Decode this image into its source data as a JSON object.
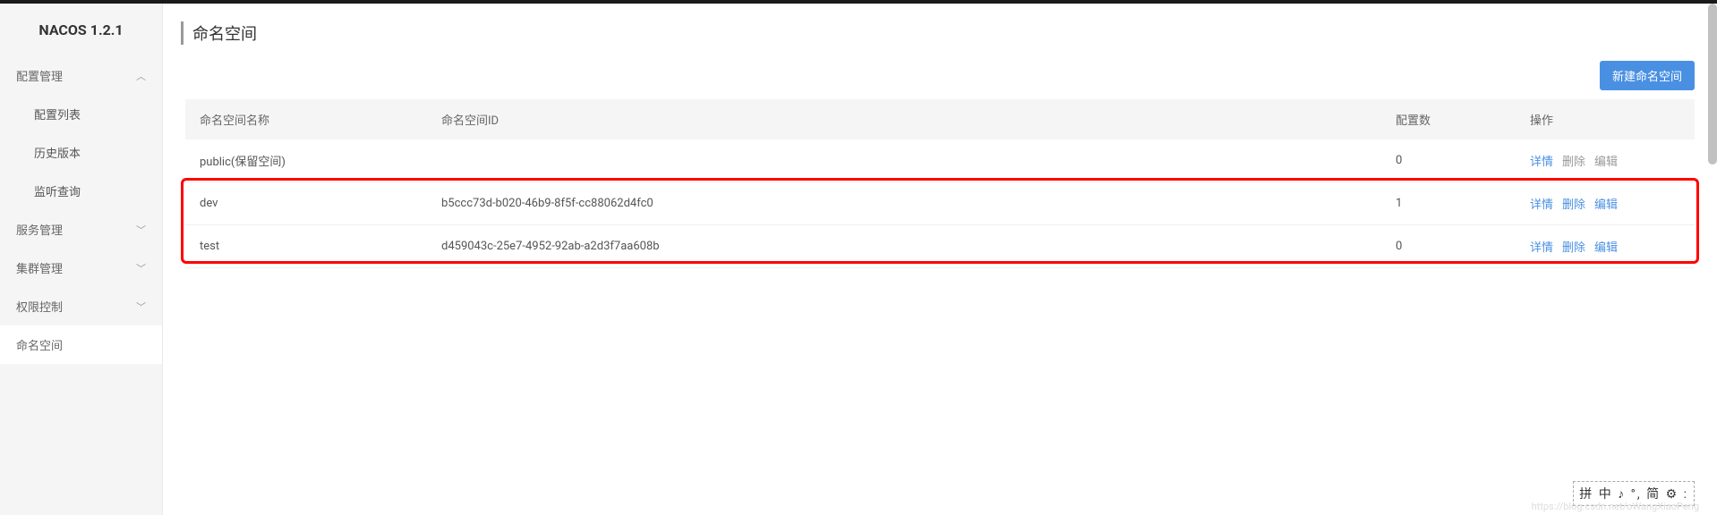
{
  "logo": "NACOS 1.2.1",
  "sidebar": {
    "configMgmt": "配置管理",
    "configList": "配置列表",
    "historyVersion": "历史版本",
    "listenQuery": "监听查询",
    "serviceMgmt": "服务管理",
    "clusterMgmt": "集群管理",
    "permissionCtrl": "权限控制",
    "namespace": "命名空间"
  },
  "page": {
    "title": "命名空间",
    "createBtn": "新建命名空间"
  },
  "table": {
    "headers": {
      "name": "命名空间名称",
      "id": "命名空间ID",
      "count": "配置数",
      "action": "操作"
    },
    "rows": [
      {
        "name": "public(保留空间)",
        "id": "",
        "count": "0",
        "detail": "详情",
        "delete": "删除",
        "edit": "编辑",
        "disabled": true
      },
      {
        "name": "dev",
        "id": "b5ccc73d-b020-46b9-8f5f-cc88062d4fc0",
        "count": "1",
        "detail": "详情",
        "delete": "删除",
        "edit": "编辑",
        "disabled": false
      },
      {
        "name": "test",
        "id": "d459043c-25e7-4952-92ab-a2d3f7aa608b",
        "count": "0",
        "detail": "详情",
        "delete": "删除",
        "edit": "编辑",
        "disabled": false
      }
    ]
  },
  "ime": "拼 中 ♪ °, 简 ⚙ :",
  "watermark": "https://blog.csdn.net/oWangXiaoPeng"
}
